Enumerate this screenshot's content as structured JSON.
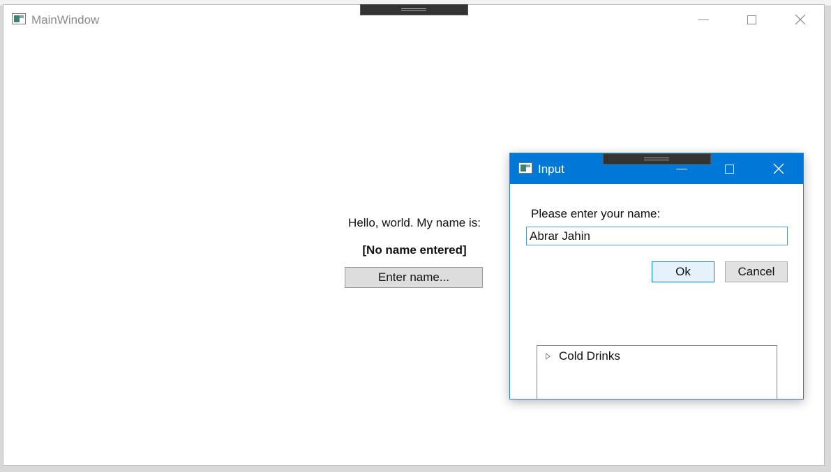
{
  "main_window": {
    "title": "MainWindow",
    "greeting": "Hello, world. My name is:",
    "name_display": "[No name entered]",
    "enter_button": "Enter name..."
  },
  "dialog": {
    "title": "Input",
    "prompt": "Please enter your name:",
    "input_value": "Abrar Jahin",
    "ok_label": "Ok",
    "cancel_label": "Cancel",
    "tree_items": [
      {
        "label": "Cold Drinks"
      }
    ]
  },
  "colors": {
    "dialog_titlebar": "#0078d7",
    "window_background": "#ffffff"
  }
}
